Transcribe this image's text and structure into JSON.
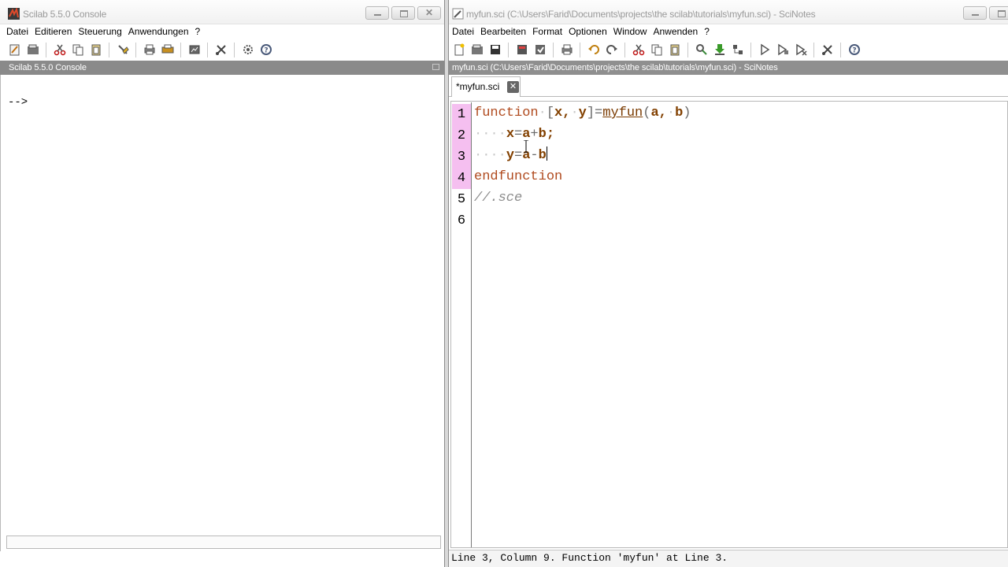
{
  "console_window": {
    "title": "Scilab 5.5.0 Console",
    "menu": [
      "Datei",
      "Editieren",
      "Steuerung",
      "Anwendungen",
      "?"
    ],
    "toolbar_icons": [
      "new-script-icon",
      "open-file-icon",
      "cut-icon",
      "copy-icon",
      "paste-icon",
      "clear-console-icon",
      "print-icon",
      "printer-setup-icon",
      "variable-browser-icon",
      "scissors-icon",
      "atoms-icon",
      "help-icon"
    ],
    "panel_header": "Scilab 5.5.0 Console",
    "prompt": "-->"
  },
  "editor_window": {
    "title": "myfun.sci (C:\\Users\\Farid\\Documents\\projects\\the scilab\\tutorials\\myfun.sci) - SciNotes",
    "menu": [
      "Datei",
      "Bearbeiten",
      "Format",
      "Optionen",
      "Window",
      "Anwenden",
      "?"
    ],
    "panel_header": "myfun.sci (C:\\Users\\Farid\\Documents\\projects\\the scilab\\tutorials\\myfun.sci) - SciNotes",
    "tab_label": "*myfun.sci",
    "line_numbers": [
      "1",
      "2",
      "3",
      "4",
      "5",
      "6"
    ],
    "code": {
      "l1_kw": "function",
      "l1_open": "[",
      "l1_x": "x",
      "l1_comma1": ",",
      "l1_y": "y",
      "l1_close": "]=",
      "l1_fn": "myfun",
      "l1_paren_open": "(",
      "l1_a": "a",
      "l1_comma2": ",",
      "l1_b": "b",
      "l1_paren_close": ")",
      "l2_x": "x",
      "l2_eq": "=",
      "l2_a": "a",
      "l2_plus": "+",
      "l2_b": "b",
      "l2_semi": ";",
      "l3_y": "y",
      "l3_eq": "=",
      "l3_a": "a",
      "l3_minus": "-",
      "l3_b": "b",
      "l4_kw": "endfunction",
      "l5_comment": "//.sce"
    },
    "status": "Line 3, Column 9. Function 'myfun' at Line 3."
  },
  "colors": {
    "line_highlight": "#f5bff0",
    "keyword": "#b04a1e",
    "variable": "#824000",
    "panel_header_bg": "#8a8a8a"
  }
}
